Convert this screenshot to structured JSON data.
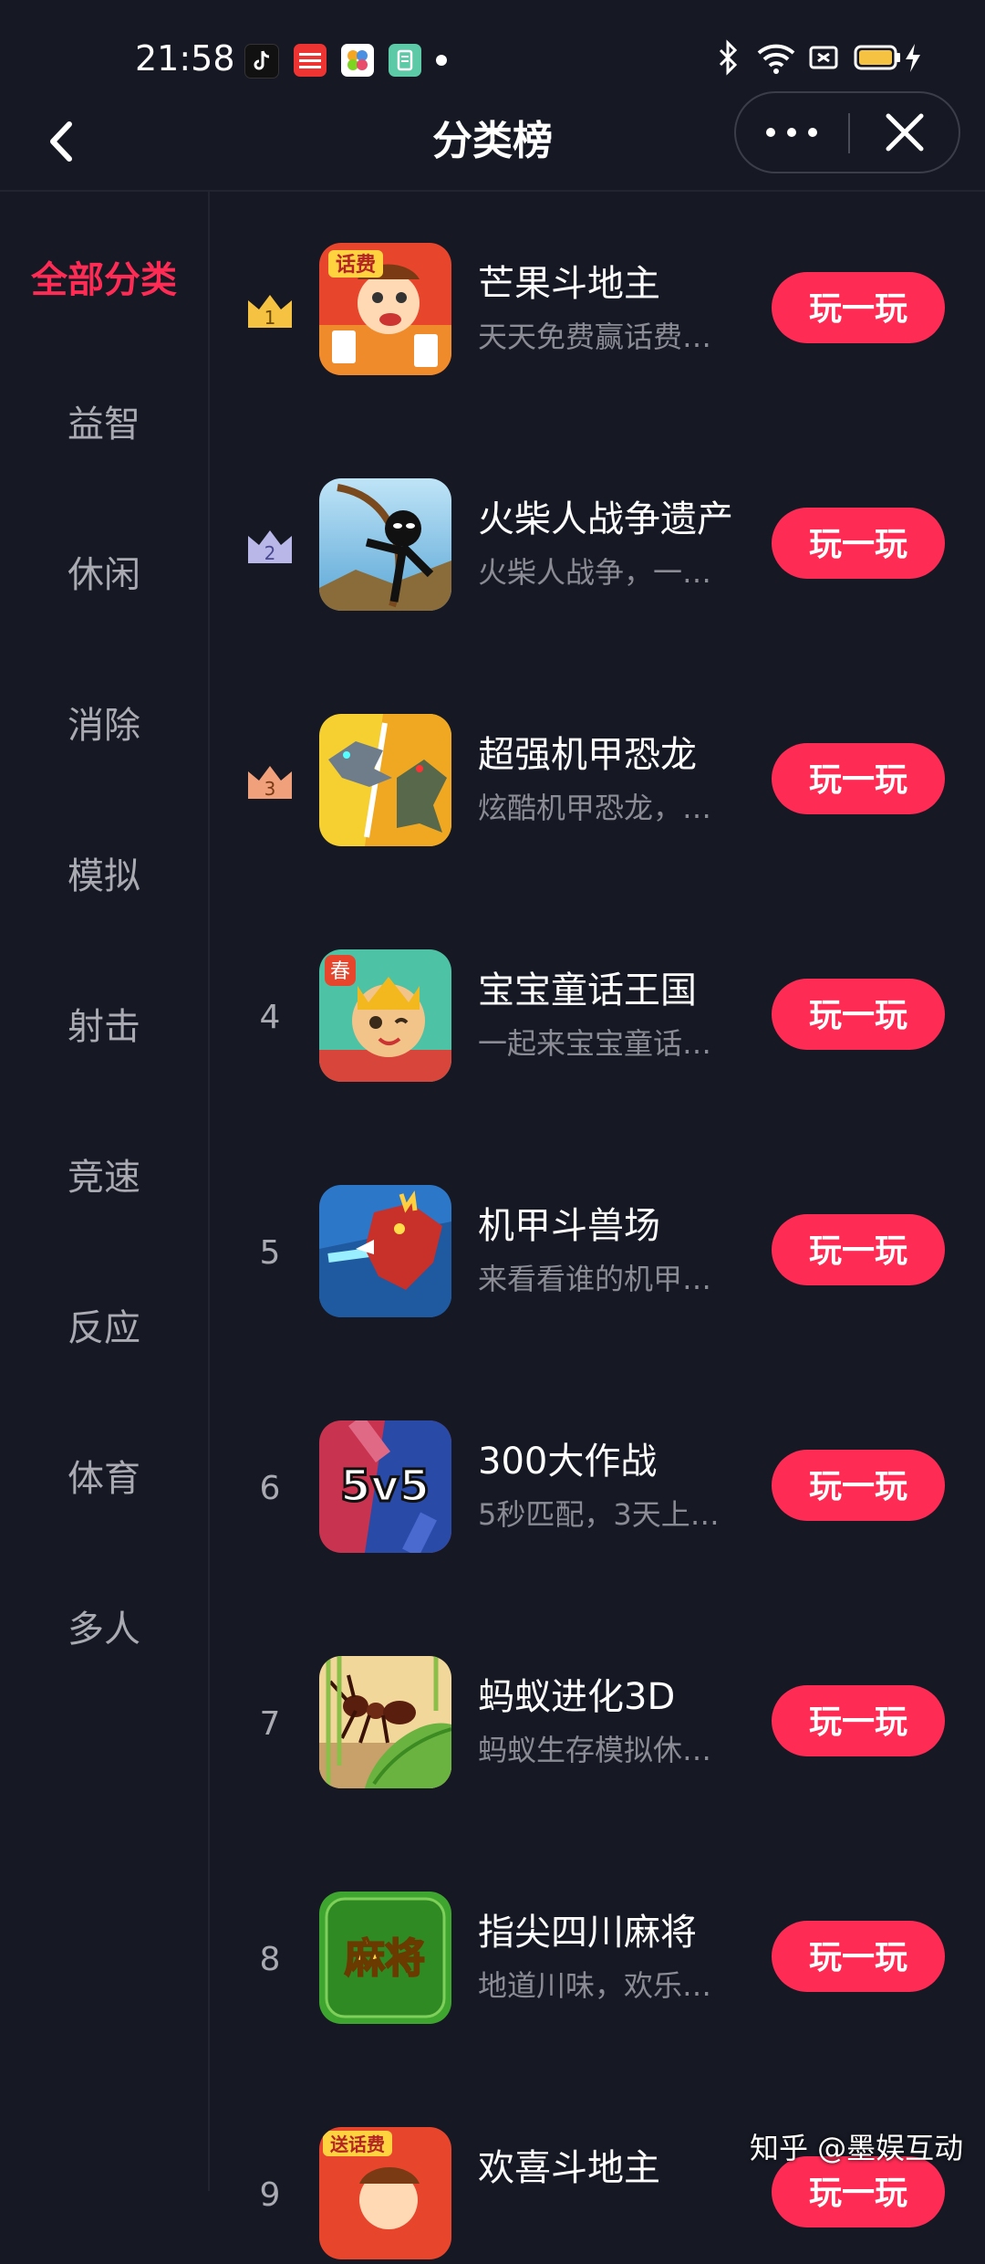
{
  "status_bar": {
    "time": "21:58",
    "notification_apps": [
      "tiktok-icon",
      "toutiao-icon",
      "photos-icon",
      "app-icon"
    ],
    "system_icons": [
      "bluetooth-icon",
      "wifi-icon",
      "nfc-icon",
      "battery-icon",
      "charging-icon"
    ]
  },
  "nav": {
    "title": "分类榜",
    "back_icon": "chevron-left-icon",
    "more_icon": "more-icon",
    "close_icon": "close-icon"
  },
  "sidebar": {
    "items": [
      {
        "label": "全部分类",
        "active": true
      },
      {
        "label": "益智",
        "active": false
      },
      {
        "label": "休闲",
        "active": false
      },
      {
        "label": "消除",
        "active": false
      },
      {
        "label": "模拟",
        "active": false
      },
      {
        "label": "射击",
        "active": false
      },
      {
        "label": "竞速",
        "active": false
      },
      {
        "label": "反应",
        "active": false
      },
      {
        "label": "体育",
        "active": false
      },
      {
        "label": "多人",
        "active": false
      }
    ]
  },
  "games": [
    {
      "rank": "1",
      "name": "芒果斗地主",
      "desc": "天天免费赢话费…",
      "button": "玩一玩",
      "icon_label": "话费"
    },
    {
      "rank": "2",
      "name": "火柴人战争遗产",
      "desc": "火柴人战争，一…",
      "button": "玩一玩",
      "icon_label": ""
    },
    {
      "rank": "3",
      "name": "超强机甲恐龙",
      "desc": "炫酷机甲恐龙，…",
      "button": "玩一玩",
      "icon_label": ""
    },
    {
      "rank": "4",
      "name": "宝宝童话王国",
      "desc": "一起来宝宝童话…",
      "button": "玩一玩",
      "icon_label": "春"
    },
    {
      "rank": "5",
      "name": "机甲斗兽场",
      "desc": "来看看谁的机甲…",
      "button": "玩一玩",
      "icon_label": ""
    },
    {
      "rank": "6",
      "name": "300大作战",
      "desc": "5秒匹配，3天上…",
      "button": "玩一玩",
      "icon_label": "5v5"
    },
    {
      "rank": "7",
      "name": "蚂蚁进化3D",
      "desc": "蚂蚁生存模拟休…",
      "button": "玩一玩",
      "icon_label": ""
    },
    {
      "rank": "8",
      "name": "指尖四川麻将",
      "desc": "地道川味，欢乐…",
      "button": "玩一玩",
      "icon_label": "麻将"
    },
    {
      "rank": "9",
      "name": "欢喜斗地主",
      "desc": "",
      "button": "玩一玩",
      "icon_label": "送话费"
    }
  ],
  "watermark": "知乎 @墨娱互动",
  "colors": {
    "accent": "#fe2c55",
    "background": "#161823",
    "gold": "#f5c242",
    "silver": "#b9b7e8",
    "bronze": "#f0a07a"
  }
}
